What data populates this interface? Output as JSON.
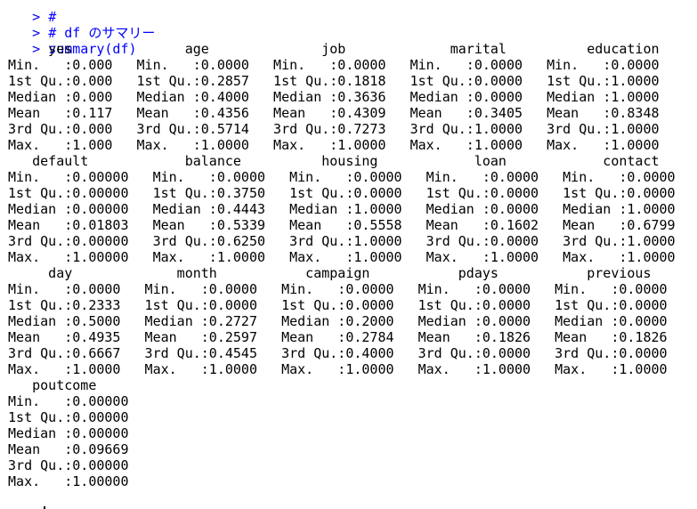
{
  "console": {
    "prompt": ">",
    "commands": [
      "#",
      "# df のサマリー",
      "summary(df)"
    ],
    "output_lines": [
      "      yes              age              job             marital          education     ",
      " Min.   :0.000   Min.   :0.0000   Min.   :0.0000   Min.   :0.0000   Min.   :0.0000  ",
      " 1st Qu.:0.000   1st Qu.:0.2857   1st Qu.:0.1818   1st Qu.:0.0000   1st Qu.:1.0000  ",
      " Median :0.000   Median :0.4000   Median :0.3636   Median :0.0000   Median :1.0000  ",
      " Mean   :0.117   Mean   :0.4356   Mean   :0.4309   Mean   :0.3405   Mean   :0.8348  ",
      " 3rd Qu.:0.000   3rd Qu.:0.5714   3rd Qu.:0.7273   3rd Qu.:1.0000   3rd Qu.:1.0000  ",
      " Max.   :1.000   Max.   :1.0000   Max.   :1.0000   Max.   :1.0000   Max.   :1.0000  ",
      "    default            balance          housing            loan            contact      ",
      " Min.   :0.00000   Min.   :0.0000   Min.   :0.0000   Min.   :0.0000   Min.   :0.0000  ",
      " 1st Qu.:0.00000   1st Qu.:0.3750   1st Qu.:0.0000   1st Qu.:0.0000   1st Qu.:0.0000  ",
      " Median :0.00000   Median :0.4443   Median :1.0000   Median :0.0000   Median :1.0000  ",
      " Mean   :0.01803   Mean   :0.5339   Mean   :0.5558   Mean   :0.1602   Mean   :0.6799  ",
      " 3rd Qu.:0.00000   3rd Qu.:0.6250   3rd Qu.:1.0000   3rd Qu.:0.0000   3rd Qu.:1.0000  ",
      " Max.   :1.00000   Max.   :1.0000   Max.   :1.0000   Max.   :1.0000   Max.   :1.0000  ",
      "      day             month           campaign           pdays           previous     ",
      " Min.   :0.0000   Min.   :0.0000   Min.   :0.0000   Min.   :0.0000   Min.   :0.0000  ",
      " 1st Qu.:0.2333   1st Qu.:0.0000   1st Qu.:0.0000   1st Qu.:0.0000   1st Qu.:0.0000  ",
      " Median :0.5000   Median :0.2727   Median :0.2000   Median :0.0000   Median :0.0000  ",
      " Mean   :0.4935   Mean   :0.2597   Mean   :0.2784   Mean   :0.1826   Mean   :0.1826  ",
      " 3rd Qu.:0.6667   3rd Qu.:0.4545   3rd Qu.:0.4000   3rd Qu.:0.0000   3rd Qu.:0.0000  ",
      " Max.   :1.0000   Max.   :1.0000   Max.   :1.0000   Max.   :1.0000   Max.   :1.0000  ",
      "    poutcome      ",
      " Min.   :0.00000  ",
      " 1st Qu.:0.00000  ",
      " Median :0.00000  ",
      " Mean   :0.09669  ",
      " 3rd Qu.:0.00000  ",
      " Max.   :1.00000  "
    ]
  },
  "colors": {
    "command_text": "#0000ff",
    "output_text": "#000000",
    "background": "#ffffff"
  }
}
